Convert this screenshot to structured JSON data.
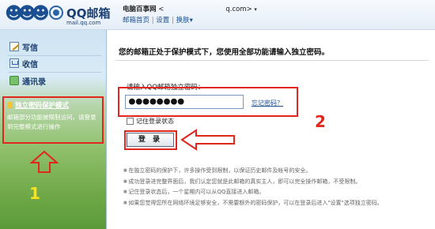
{
  "header": {
    "brand": "QQ邮箱",
    "domain": "mail.qq.com",
    "account_name": "电脑百事网",
    "account_email": "<",
    "account_email_suffix": "q.com>",
    "account_dropdown": "▾",
    "links": [
      {
        "label": "邮箱首页"
      },
      {
        "label": "设置"
      },
      {
        "label": "换肤",
        "suffix": "▾"
      }
    ]
  },
  "sidebar": {
    "items": [
      {
        "label": "写信",
        "icon": "compose-icon"
      },
      {
        "label": "收信",
        "icon": "inbox-icon"
      },
      {
        "label": "通讯录",
        "icon": "contacts-icon"
      }
    ],
    "protect": {
      "title": "独立密码保护模式",
      "desc": "邮箱部分功能被限制访问，请登录到完整模式进行操作"
    },
    "annotation": "1"
  },
  "main": {
    "title": "您的邮箱正处于保护模式下，您使用全部功能请输入独立密码。",
    "password_label": "请输入QQ邮箱独立密码：",
    "password_value": "●●●●●●●●",
    "forgot_link": "忘记密码？",
    "remember_label": "记住登录状态",
    "login_button": "登 录",
    "annotation": "2",
    "tips": [
      "在独立密码的保护下，许多操作受到限制，以保证历史邮件及帐号的安全。",
      "成功登录进完整界面后，我们认定您就是此邮箱的真实主人，即可以完全操作邮箱，不受限制。",
      "记住登录状态后，一个星期内可以从QQ直接进入邮箱。",
      "如果您觉得您所在网络环境足够安全，不需要额外的密码保护，可以在登录后进入\"设置\"选项独立密码。"
    ]
  },
  "colors": {
    "highlight_red": "#e0261d",
    "annotation_yellow": "#ffe11a",
    "link_blue": "#1d4f91"
  }
}
